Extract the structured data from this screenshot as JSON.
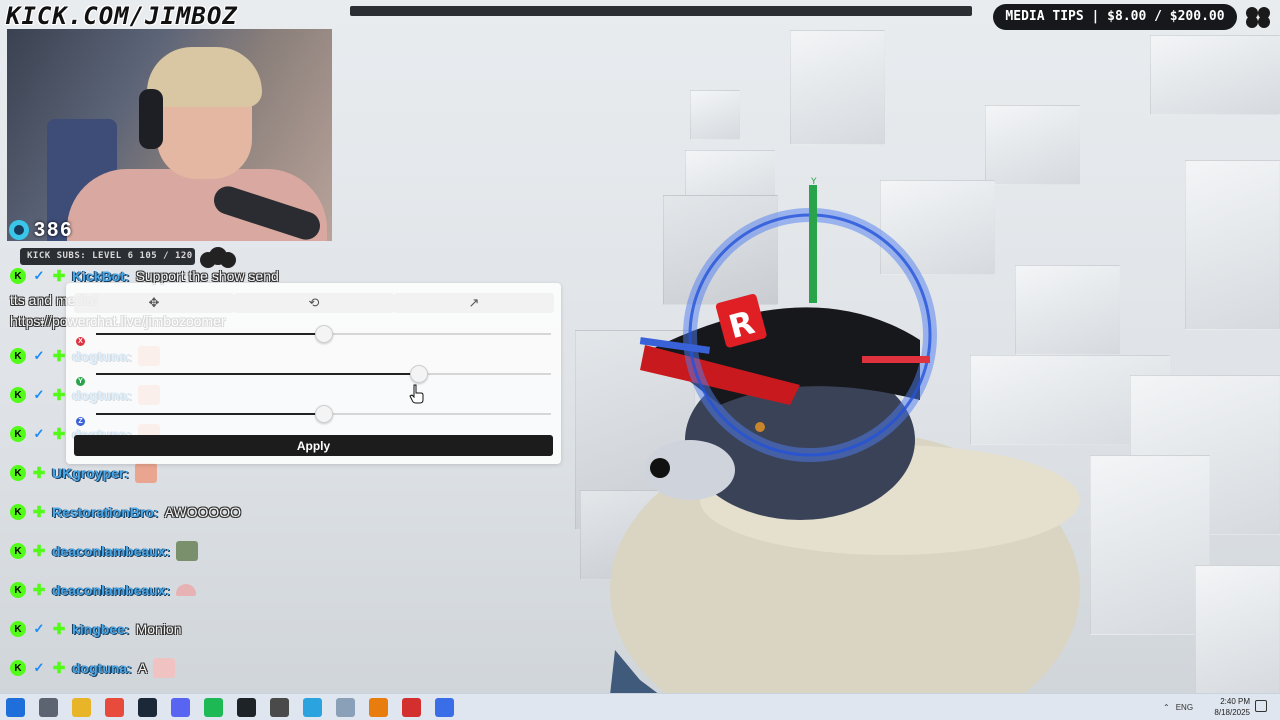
{
  "channel": {
    "logo_text": "KICK.COM/JIMBOZ"
  },
  "media_tips": {
    "text": "MEDIA TIPS | $8.00 / $200.00"
  },
  "webcam": {
    "viewer_count": "386"
  },
  "subs_goal": {
    "text": "KICK SUBS: LEVEL 6 105 / 120"
  },
  "chat": {
    "messages": [
      {
        "user": "KickBot:",
        "text": "Support the show send",
        "badges": [
          "k",
          "mod",
          "sub"
        ]
      },
      {
        "user": "",
        "text": "tts and media!",
        "badges": []
      },
      {
        "user": "",
        "text": "https://powerchat.live/jimbozoomer",
        "badges": []
      },
      {
        "user": "dogtuna:",
        "text": "",
        "badges": [
          "k",
          "mod",
          "sub"
        ],
        "emote": "face"
      },
      {
        "user": "dogtuna:",
        "text": "",
        "badges": [
          "k",
          "mod",
          "sub"
        ],
        "emote": "face"
      },
      {
        "user": "dogtuna:",
        "text": "",
        "badges": [
          "k",
          "mod",
          "sub"
        ],
        "emote": "face"
      },
      {
        "user": "UKgroyper:",
        "text": "",
        "badges": [
          "k",
          "sub"
        ],
        "emote": "face"
      },
      {
        "user": "RestorationBro:",
        "text": "AWOOOOO",
        "badges": [
          "k",
          "sub"
        ]
      },
      {
        "user": "deaconlambeaux:",
        "text": "",
        "badges": [
          "k",
          "sub"
        ],
        "emote": "green"
      },
      {
        "user": "deaconlambeaux:",
        "text": "",
        "badges": [
          "k",
          "sub"
        ],
        "emote": "pink"
      },
      {
        "user": "kingbee:",
        "text": "Monion",
        "badges": [
          "k",
          "mod",
          "sub"
        ]
      },
      {
        "user": "dogtuna:",
        "text": "A",
        "badges": [
          "k",
          "mod",
          "sub"
        ],
        "emote": "gif"
      }
    ]
  },
  "gizmo_panel": {
    "tools": [
      "move-icon",
      "rotate-icon",
      "external-link-icon"
    ],
    "sliders": [
      {
        "axis": "X",
        "color": "#e0313f",
        "value": 0.5
      },
      {
        "axis": "Y",
        "color": "#2aa44b",
        "value": 0.71
      },
      {
        "axis": "Z",
        "color": "#3a62d8",
        "value": 0.5
      }
    ],
    "apply_label": "Apply"
  },
  "taskbar": {
    "apps": [
      {
        "name": "windows-start-icon",
        "color": "#1e6fd9"
      },
      {
        "name": "task-view-icon",
        "color": "#5b6470"
      },
      {
        "name": "file-explorer-icon",
        "color": "#e8b428"
      },
      {
        "name": "chrome-icon",
        "color": "#e84a3c"
      },
      {
        "name": "steam-icon",
        "color": "#1b2838"
      },
      {
        "name": "discord-icon",
        "color": "#5865f2"
      },
      {
        "name": "spotify-icon",
        "color": "#1db954"
      },
      {
        "name": "terminal-icon",
        "color": "#1e2328"
      },
      {
        "name": "obs-icon",
        "color": "#4a4a4a"
      },
      {
        "name": "telegram-icon",
        "color": "#2aa3df"
      },
      {
        "name": "notepad-icon",
        "color": "#8aa0b8"
      },
      {
        "name": "blender-icon",
        "color": "#e87d0d"
      },
      {
        "name": "adobe-icon",
        "color": "#d32f2f"
      },
      {
        "name": "roblox-studio-icon",
        "color": "#3a6ee8"
      }
    ],
    "tray_lang": "ENG",
    "time": "2:40 PM",
    "date": "8/18/2025"
  }
}
